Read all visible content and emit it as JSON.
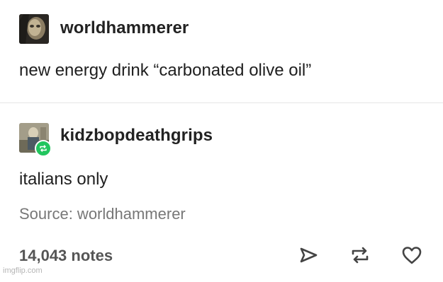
{
  "post": {
    "author": "worldhammerer",
    "text": "new energy drink “carbonated olive oil”"
  },
  "reblog": {
    "author": "kidzbopdeathgrips",
    "text": "italians only",
    "source": "Source: worldhammerer"
  },
  "footer": {
    "notes": "14,043 notes",
    "actions": [
      "send-icon",
      "reblog-icon",
      "heart-icon"
    ]
  },
  "watermark": "imgflip.com",
  "colors": {
    "reblog_badge": "#22c55e",
    "text": "#222222",
    "muted": "#777777"
  }
}
